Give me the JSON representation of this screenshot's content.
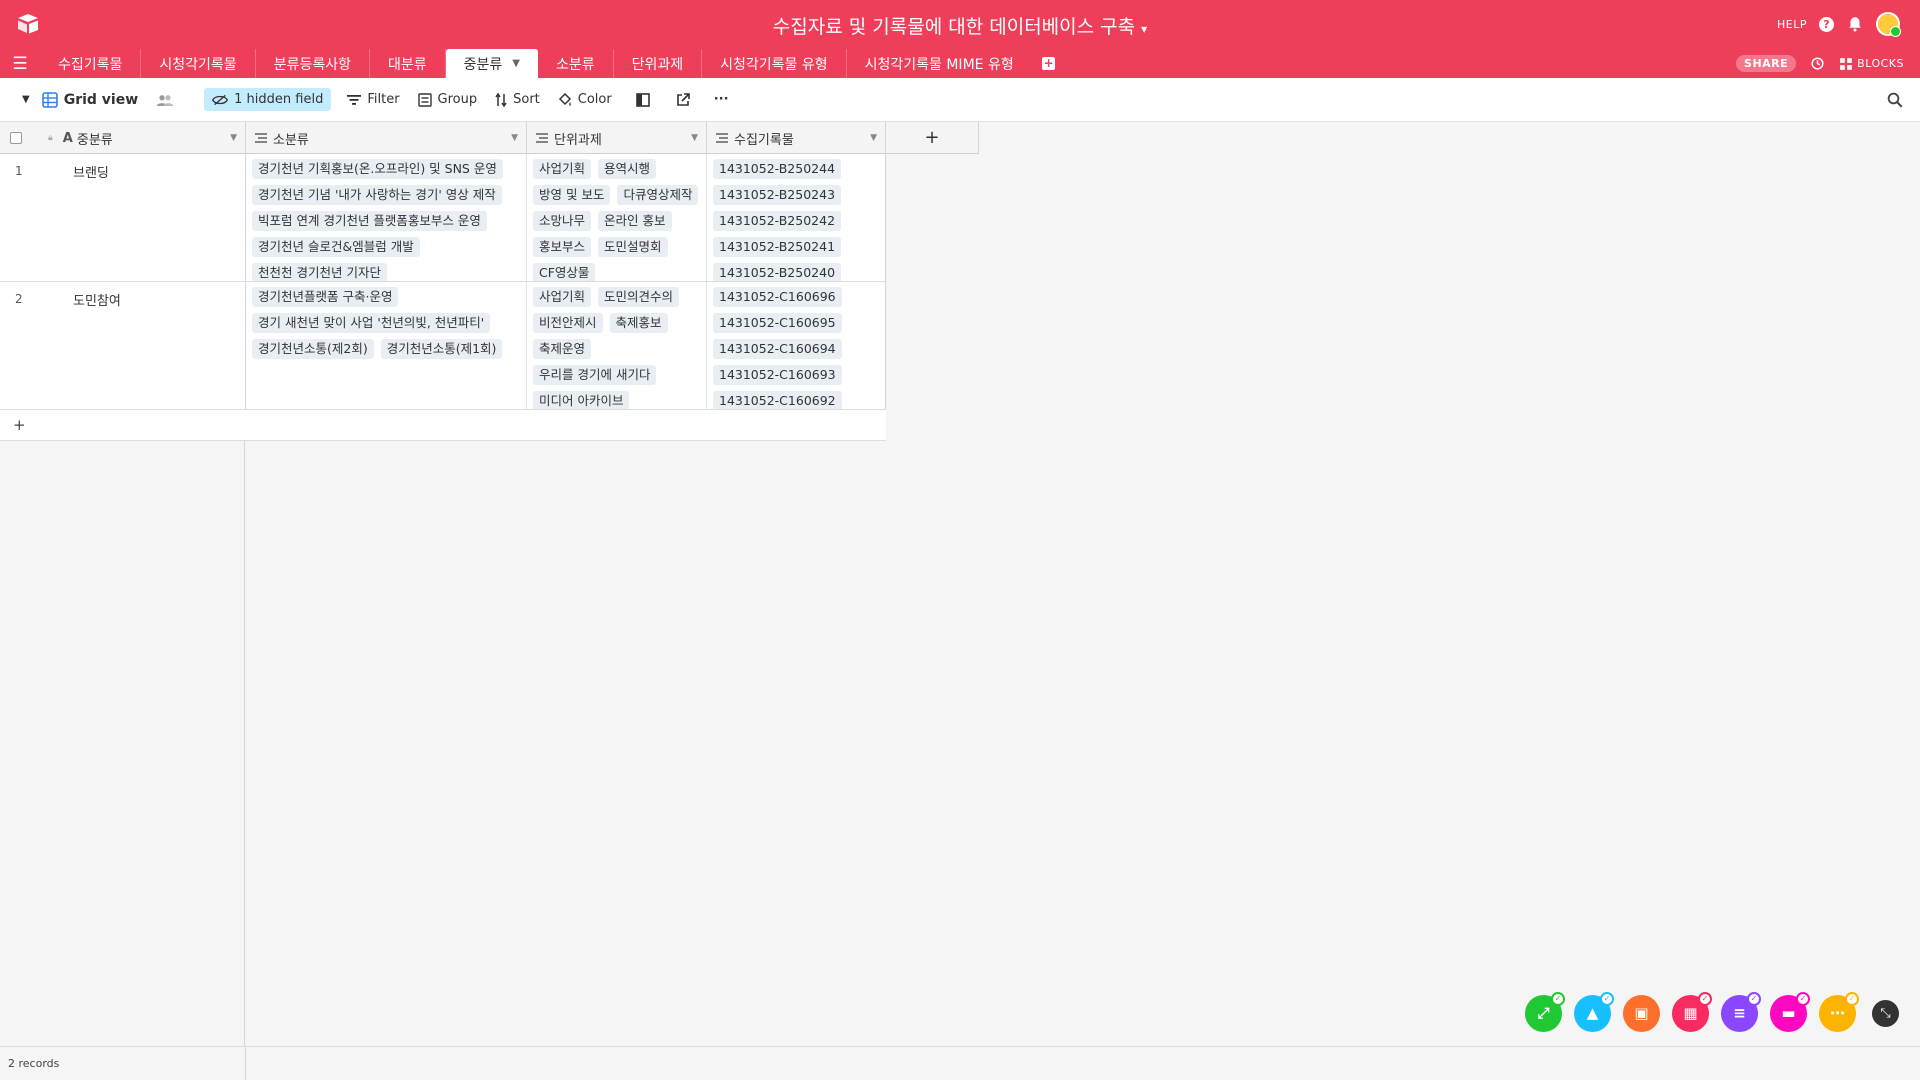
{
  "header": {
    "base_title": "수집자료 및 기록물에 대한 데이터베이스 구축",
    "title_caret": "▾",
    "help_label": "HELP",
    "accent_color": "#ef3e5a"
  },
  "tabs": {
    "items": [
      {
        "label": "수집기록물"
      },
      {
        "label": "시청각기록물"
      },
      {
        "label": "분류등록사항"
      },
      {
        "label": "대분류"
      },
      {
        "label": "중분류",
        "active": true
      },
      {
        "label": "소분류"
      },
      {
        "label": "단위과제"
      },
      {
        "label": "시청각기록물 유형"
      },
      {
        "label": "시청각기록물 MIME 유형"
      }
    ],
    "share_label": "SHARE",
    "blocks_label": "BLOCKS"
  },
  "viewbar": {
    "view_name": "Grid view",
    "hidden_fields": "1 hidden field",
    "filter": "Filter",
    "group": "Group",
    "sort": "Sort",
    "color": "Color",
    "more": "···"
  },
  "grid": {
    "columns": [
      {
        "name": "중분류",
        "type": "text"
      },
      {
        "name": "소분류",
        "type": "link"
      },
      {
        "name": "단위과제",
        "type": "link"
      },
      {
        "name": "수집기록물",
        "type": "link"
      }
    ],
    "add_field": "+",
    "rows": [
      {
        "num": "1",
        "name": "브랜딩",
        "sub": [
          "경기천년 기획홍보(온.오프라인) 및 SNS 운영",
          "경기천년 기념 '내가 사랑하는 경기' 영상 제작",
          "빅포럼 연계 경기천년 플랫폼홍보부스 운영",
          "경기천년 슬로건&엠블럼 개발",
          "천천천 경기천년 기자단"
        ],
        "tasks": [
          "사업기획",
          "용역시행",
          "방영 및 보도",
          "다큐영상제작",
          "소망나무",
          "온라인 홍보",
          "홍보부스",
          "도민설명회",
          "CF영상물"
        ],
        "records": [
          "1431052-B250244",
          "1431052-B250243",
          "1431052-B250242",
          "1431052-B250241",
          "1431052-B250240"
        ]
      },
      {
        "num": "2",
        "name": "도민참여",
        "sub": [
          "경기천년플랫폼 구축·운영",
          "경기 새천년 맞이 사업 '천년의빛, 천년파티'",
          "경기천년소통(제2회)",
          "경기천년소통(제1회)"
        ],
        "tasks": [
          "사업기획",
          "도민의견수의",
          "비전안제시",
          "축제홍보",
          "축제운영",
          "우리를 경기에 새기다",
          "미디어 아카이브"
        ],
        "records": [
          "1431052-C160696",
          "1431052-C160695",
          "1431052-C160694",
          "1431052-C160693",
          "1431052-C160692"
        ]
      }
    ],
    "add_row": "+"
  },
  "footer": {
    "record_count": "2 records"
  },
  "dock": {
    "buttons": [
      {
        "icon": "expand-icon",
        "color": "#20c933"
      },
      {
        "icon": "shapes-icon",
        "color": "#18bfff"
      },
      {
        "icon": "image-icon",
        "color": "#ff6f2c"
      },
      {
        "icon": "apps-icon",
        "color": "#f82b60"
      },
      {
        "icon": "list-icon",
        "color": "#8b46ff"
      },
      {
        "icon": "chat-icon",
        "color": "#ff08c2"
      },
      {
        "icon": "more-icon",
        "color": "#fcb400"
      }
    ]
  }
}
